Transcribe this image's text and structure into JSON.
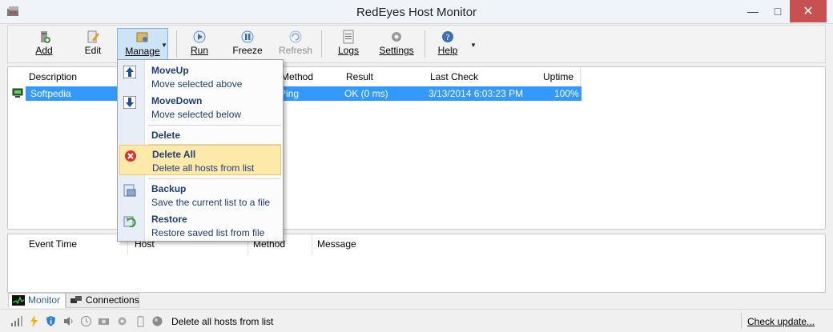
{
  "window": {
    "title": "RedEyes Host Monitor"
  },
  "toolbar": {
    "add": "Add",
    "edit": "Edit",
    "manage": "Manage",
    "run": "Run",
    "freeze": "Freeze",
    "refresh": "Refresh",
    "logs": "Logs",
    "settings": "Settings",
    "help": "Help"
  },
  "hosts_table": {
    "columns": [
      "Description",
      "Method",
      "Result",
      "Last Check",
      "Uptime"
    ],
    "rows": [
      {
        "description": "Softpedia",
        "method": "Ping",
        "result": "OK (0 ms)",
        "last_check": "3/13/2014 6:03:23 PM",
        "uptime": "100%"
      }
    ]
  },
  "events_table": {
    "columns": [
      "Event Time",
      "Host",
      "Method",
      "Message"
    ]
  },
  "manage_menu": {
    "items": [
      {
        "title": "MoveUp",
        "desc": "Move selected above",
        "icon": "arrow-up-icon"
      },
      {
        "title": "MoveDown",
        "desc": "Move selected below",
        "icon": "arrow-down-icon"
      },
      {
        "title": "Delete",
        "desc": ""
      },
      {
        "title": "Delete All",
        "desc": "Delete all hosts from list",
        "icon": "delete-all-icon"
      },
      {
        "title": "Backup",
        "desc": "Save the current list to a file",
        "icon": "backup-icon"
      },
      {
        "title": "Restore",
        "desc": "Restore saved list from file",
        "icon": "restore-icon"
      }
    ]
  },
  "tabs": {
    "monitor": "Monitor",
    "connections": "Connections"
  },
  "statusbar": {
    "message": "Delete all hosts from list",
    "check_update": "Check update..."
  },
  "colors": {
    "selection": "#3399ff",
    "menu_text": "#1f3d7a",
    "menu_hover": "#fde9a8",
    "close_button": "#c75050"
  }
}
